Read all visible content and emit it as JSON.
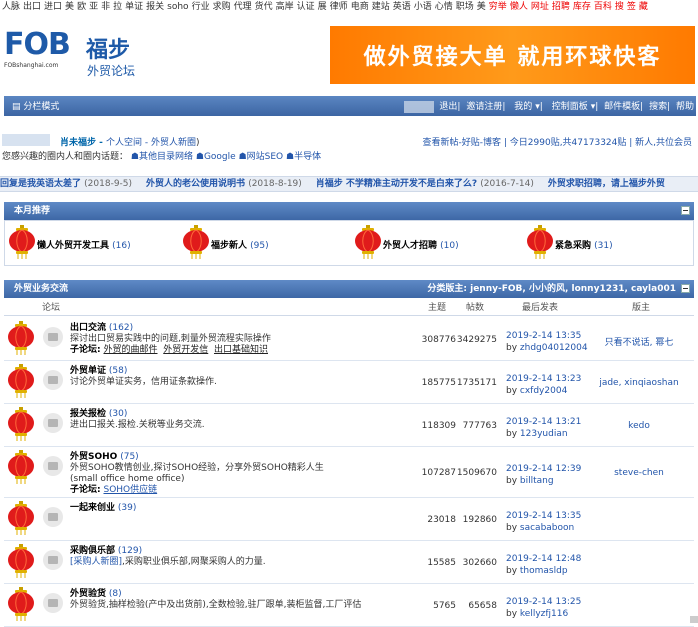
{
  "topnav": {
    "items": [
      {
        "label": "人脉",
        "hot": false
      },
      {
        "label": "出口",
        "hot": false
      },
      {
        "label": "进口",
        "hot": false
      },
      {
        "label": "美",
        "hot": false
      },
      {
        "label": "欧",
        "hot": false
      },
      {
        "label": "亚",
        "hot": false
      },
      {
        "label": "非",
        "hot": false
      },
      {
        "label": "拉",
        "hot": false
      },
      {
        "label": "单证",
        "hot": false
      },
      {
        "label": "报关",
        "hot": false
      },
      {
        "label": "soho",
        "hot": false
      },
      {
        "label": "行业",
        "hot": false
      },
      {
        "label": "求购",
        "hot": false
      },
      {
        "label": "代理",
        "hot": false
      },
      {
        "label": "货代",
        "hot": false
      },
      {
        "label": "高岸",
        "hot": false
      },
      {
        "label": "认证",
        "hot": false
      },
      {
        "label": "展",
        "hot": false
      },
      {
        "label": "律师",
        "hot": false
      },
      {
        "label": "电商",
        "hot": false
      },
      {
        "label": "建站",
        "hot": false
      },
      {
        "label": "英语",
        "hot": false
      },
      {
        "label": "小语",
        "hot": false
      },
      {
        "label": "心情",
        "hot": false
      },
      {
        "label": "职场",
        "hot": false
      },
      {
        "label": "美",
        "hot": false
      },
      {
        "label": "穷举",
        "hot": true
      },
      {
        "label": "懒人",
        "hot": true
      },
      {
        "label": "网址",
        "hot": true
      },
      {
        "label": "招聘",
        "hot": true
      },
      {
        "label": "库存",
        "hot": true
      },
      {
        "label": "百科",
        "hot": true
      },
      {
        "label": "搜",
        "hot": true
      },
      {
        "label": "签",
        "hot": true
      },
      {
        "label": "藏",
        "hot": true
      }
    ]
  },
  "header": {
    "logo_text": "FOB",
    "logo_sub": "FOBshanghai.com",
    "logo_cn": "福步",
    "logo_cn2": "外贸论坛",
    "banner_text": "做外贸接大单  就用环球快客"
  },
  "navbar": {
    "mode": "分栏模式",
    "links": [
      "退出",
      "邀请注册",
      "我的",
      "控制面板",
      "邮件模板",
      "搜索",
      "帮助"
    ]
  },
  "user": {
    "space_prefix": "肖未福步 - ",
    "space_link": "个人空间 - 外贸人新圈",
    "space_suffix": ")",
    "stats": "查看新帖-好贴-博客 | 今日2990贴,共47173324贴 | 新人,共位会员",
    "circles_label": "您感兴趣的圈内人和圈内话题：",
    "circles": [
      "其他目录网络",
      "Google",
      "网站SEO",
      "半导体"
    ]
  },
  "ticker": [
    {
      "title": "回复是我英语太差了",
      "date": "(2018-9-5)"
    },
    {
      "title": "外贸人的老公使用说明书",
      "date": "(2018-8-19)"
    },
    {
      "title": "肖福步 不学精准主动开发不是白来了么?",
      "date": "(2016-7-14)"
    },
    {
      "title": "外贸求职招聘，请上福步外贸",
      "date": ""
    }
  ],
  "featured": {
    "header": "本月推荐",
    "items": [
      {
        "name": "懒人外贸开发工具",
        "count": "(16)"
      },
      {
        "name": "福步新人",
        "count": "(95)"
      },
      {
        "name": "外贸人才招聘",
        "count": "(10)"
      },
      {
        "name": "紧急采购",
        "count": "(31)"
      }
    ]
  },
  "section": {
    "title": "外贸业务交流",
    "moderators": "分类版主: jenny-FOB, 小小的风, lonny1231, cayla001",
    "col_forum": "论坛",
    "col_topics": "主题",
    "col_posts": "帖数",
    "col_last": "最后发表",
    "col_mod": "版主"
  },
  "forums": [
    {
      "name": "出口交流",
      "count": "(162)",
      "desc": "探讨出口贸易实践中的问题,刺量外贸流程实际操作",
      "sub_label": "子论坛:",
      "subs": [
        "外贸的曲邮件",
        "外贸开发信",
        "出口基础知识"
      ],
      "topics": "308776",
      "posts": "3429275",
      "date": "2019-2-14 13:35",
      "by": "zhdg04012004",
      "mod": "只看不说话, 幂七",
      "icon": "chat-icon"
    },
    {
      "name": "外贸单证",
      "count": "(58)",
      "desc": "讨论外贸单证实务，信用证条款操作.",
      "sub_label": "",
      "subs": [],
      "topics": "185775",
      "posts": "1735171",
      "date": "2019-2-14 13:23",
      "by": "cxfdy2004",
      "mod": "jade, xinqiaoshan",
      "icon": "document-icon"
    },
    {
      "name": "报关报检",
      "count": "(30)",
      "desc": "进出口报关.报检.关税等业务交流.",
      "sub_label": "",
      "subs": [],
      "topics": "118309",
      "posts": "777763",
      "date": "2019-2-14 13:21",
      "by": "123yudian",
      "mod": "kedo",
      "icon": "customs-icon"
    },
    {
      "name": "外贸SOHO",
      "count": "(75)",
      "desc": "外贸SOHO教情创业,探讨SOHO经验，分享外贸SOHO精彩人生",
      "desc2": "(small office home office)",
      "sub_label": "子论坛:",
      "subs": [
        "SOHO供应链"
      ],
      "topics": "107287",
      "posts": "1509670",
      "date": "2019-2-14 12:39",
      "by": "billtang",
      "mod": "steve-chen",
      "icon": "soho-icon"
    },
    {
      "name": "一起来创业",
      "count": "(39)",
      "desc": "",
      "sub_label": "",
      "subs": [],
      "topics": "23018",
      "posts": "192860",
      "date": "2019-2-14 13:35",
      "by": "sacababoon",
      "mod": "",
      "icon": "group-icon"
    },
    {
      "name": "采购俱乐部",
      "count": "(129)",
      "desc_link": "[采购人新圈]",
      "desc": ",采购职业俱乐部,网聚采购人的力量.",
      "sub_label": "",
      "subs": [],
      "topics": "15585",
      "posts": "302660",
      "date": "2019-2-14 12:48",
      "by": "thomasldp",
      "mod": "",
      "icon": "cart-icon"
    },
    {
      "name": "外贸验货",
      "count": "(8)",
      "desc": "外贸验货,抽样检验(产中及出货前),全数检验,驻厂跟单,装柜监督,工厂评估",
      "sub_label": "",
      "subs": [],
      "topics": "5765",
      "posts": "65658",
      "date": "2019-2-14 13:25",
      "by": "kellyzfj116",
      "mod": "",
      "icon": "inspect-icon"
    }
  ],
  "colors": {
    "nav_blue": "#3d67a6",
    "link": "#2255aa",
    "hot": "#e00000",
    "banner": "#ff8000"
  }
}
